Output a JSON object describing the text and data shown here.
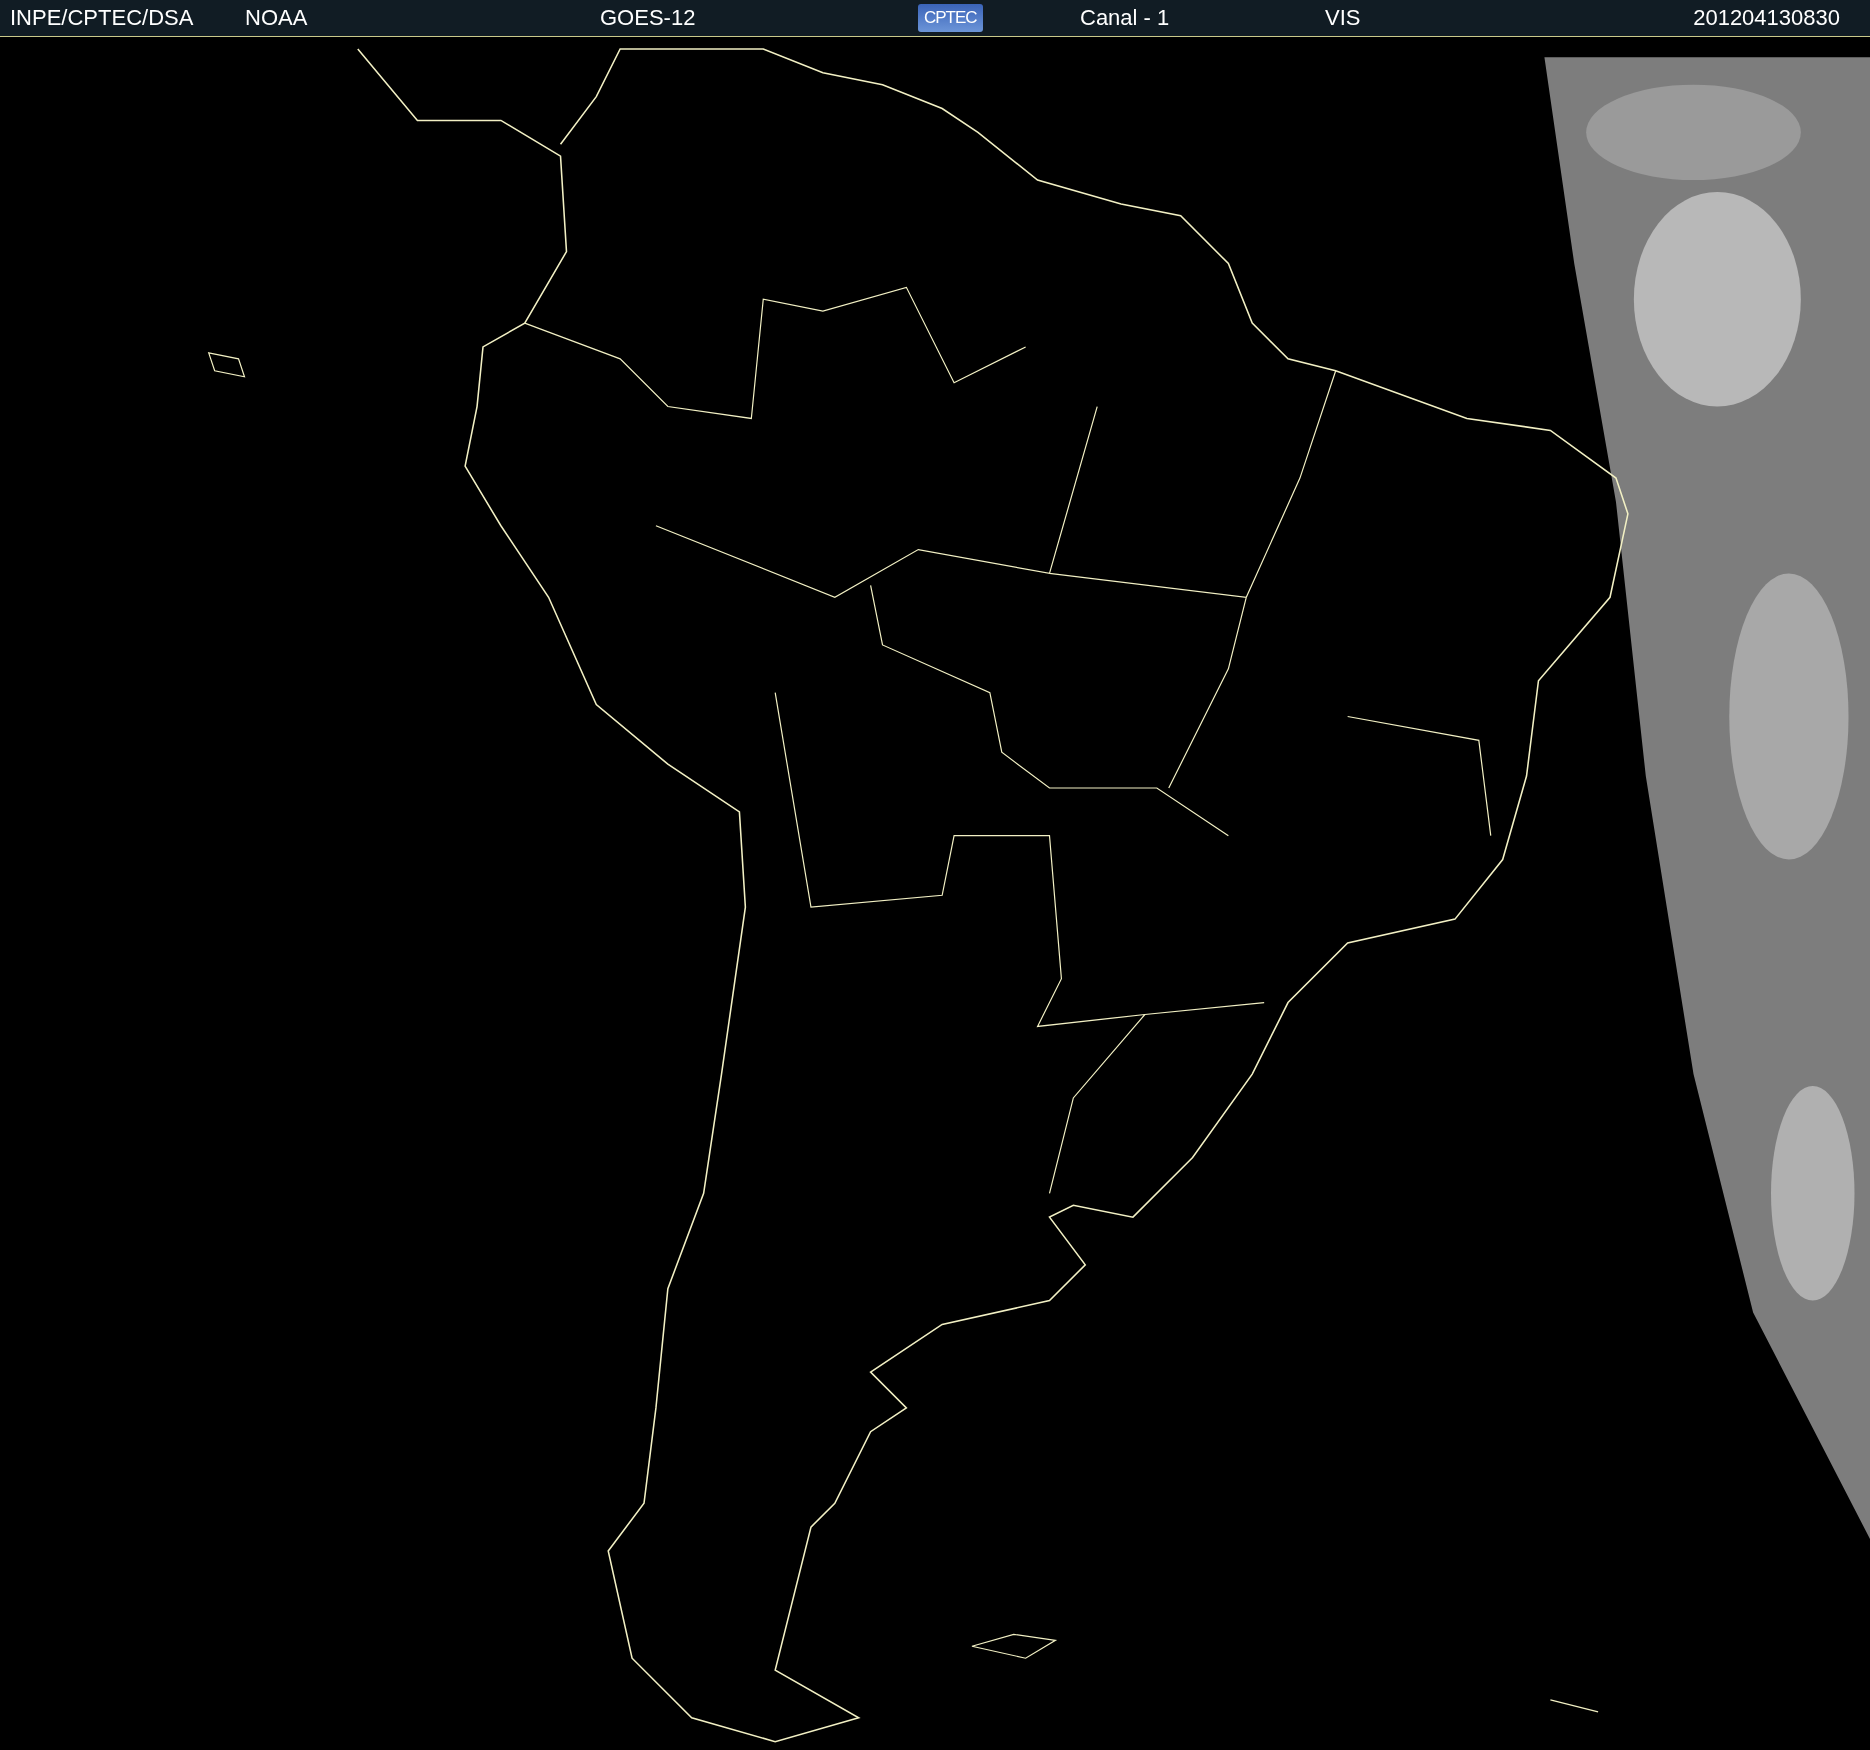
{
  "header": {
    "items": [
      {
        "kind": "text",
        "text": "INPE/CPTEC/DSA"
      },
      {
        "kind": "text",
        "text": "NOAA"
      },
      {
        "kind": "text",
        "text": "GOES-12"
      },
      {
        "kind": "logo",
        "text": "CPTEC"
      },
      {
        "kind": "text",
        "text": "Canal - 1"
      },
      {
        "kind": "text",
        "text": "VIS"
      },
      {
        "kind": "text",
        "text": "201204130830"
      }
    ]
  }
}
